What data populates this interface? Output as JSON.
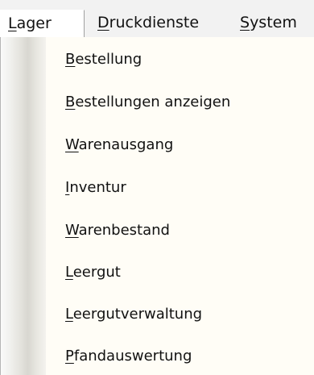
{
  "menubar": {
    "items": [
      {
        "first": "L",
        "rest": "ager"
      },
      {
        "first": "D",
        "rest": "ruckdienste"
      },
      {
        "first": "S",
        "rest": "ystem"
      }
    ]
  },
  "dropdown": {
    "items": [
      {
        "first": "B",
        "rest": "estellung"
      },
      {
        "first": "B",
        "rest": "estellungen anzeigen"
      },
      {
        "first": "W",
        "rest": "arenausgang"
      },
      {
        "first": "I",
        "rest": "nventur"
      },
      {
        "first": "W",
        "rest": "arenbestand"
      },
      {
        "first": "L",
        "rest": "eergut"
      },
      {
        "first": "L",
        "rest": "eergutverwaltung"
      },
      {
        "first": "P",
        "rest": "fandauswertung"
      }
    ]
  },
  "colors": {
    "menu_background": "#fffdf6",
    "menubar_background": "#f2f2f2"
  }
}
